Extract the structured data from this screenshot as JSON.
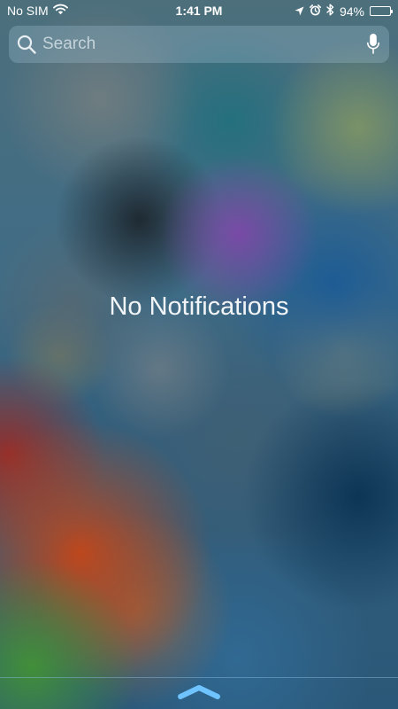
{
  "status_bar": {
    "carrier": "No SIM",
    "time": "1:41 PM",
    "battery_percent": "94%",
    "battery_level": 0.94,
    "icons": [
      "wifi-icon",
      "location-arrow-icon",
      "alarm-icon",
      "bluetooth-icon",
      "battery-icon"
    ]
  },
  "search": {
    "placeholder": "Search",
    "value": "",
    "icons": [
      "search-icon",
      "microphone-icon"
    ]
  },
  "notifications": {
    "empty_message": "No Notifications"
  },
  "bottom": {
    "icons": [
      "chevron-up-icon"
    ],
    "accent_color": "#6fc3ff"
  }
}
